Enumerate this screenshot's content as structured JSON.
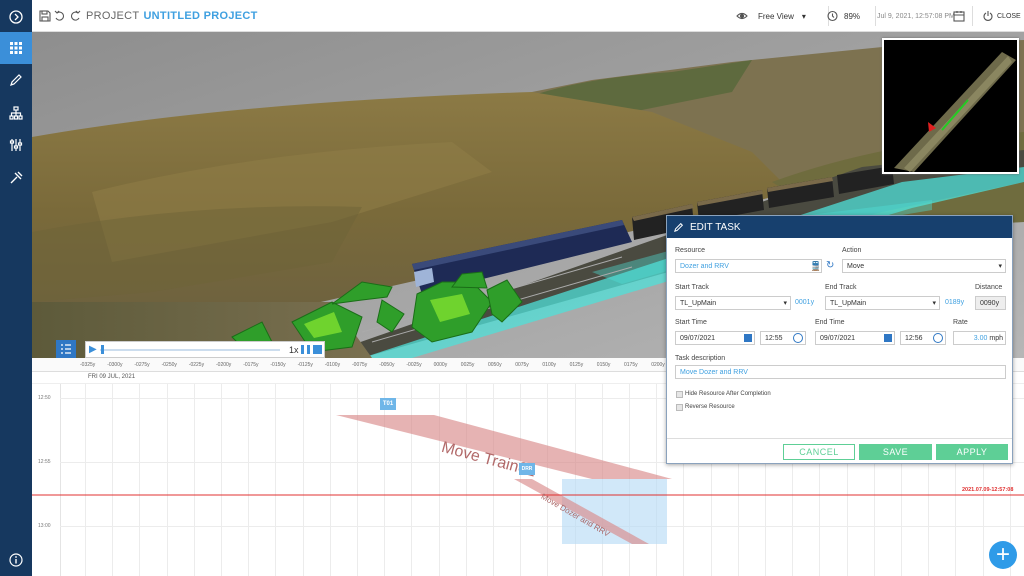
{
  "topbar": {
    "project_prefix": "PROJECT",
    "project_name": "UNTITLED PROJECT",
    "view_mode": "Free View",
    "zoom": "89%",
    "datetime": "Jul 9, 2021, 12:57:08 PM",
    "close_label": "CLOSE"
  },
  "playback": {
    "speed": "1x"
  },
  "timeline": {
    "date_label": "FRI 09 JUL, 2021",
    "ruler_ticks": [
      "-0325y",
      "-0300y",
      "-0275y",
      "-0250y",
      "-0225y",
      "-0200y",
      "-0175y",
      "-0150y",
      "-0125y",
      "-0100y",
      "-0075y",
      "-0050y",
      "-0025y",
      "0000y",
      "0025y",
      "0050y",
      "0075y",
      "0100y",
      "0125y",
      "0150y",
      "0175y",
      "0200y"
    ],
    "time_labels": [
      "12:50",
      "12:55",
      "13:00"
    ],
    "now_label": "2021.07.09-12:57:08",
    "tasks": [
      {
        "badge": "T01",
        "label": "Move Train01"
      },
      {
        "badge": "DRR",
        "label": "Move Dozer and RRV"
      }
    ]
  },
  "edit_task": {
    "title": "EDIT TASK",
    "resource_label": "Resource",
    "resource_value": "Dozer and RRV",
    "action_label": "Action",
    "action_value": "Move",
    "start_track_label": "Start Track",
    "start_track_value": "TL_UpMain",
    "start_track_offset": "0001y",
    "end_track_label": "End Track",
    "end_track_value": "TL_UpMain",
    "end_track_offset": "0189y",
    "distance_label": "Distance",
    "distance_value": "0090y",
    "start_time_label": "Start Time",
    "start_date": "09/07/2021",
    "start_clock": "12:55",
    "end_time_label": "End Time",
    "end_date": "09/07/2021",
    "end_clock": "12:56",
    "rate_label": "Rate",
    "rate_value": "3.00",
    "rate_unit": "mph",
    "desc_label": "Task description",
    "desc_value": "Move Dozer and RRV",
    "hide_label": "Hide Resource After Completion",
    "reverse_label": "Reverse Resource",
    "cancel": "CANCEL",
    "save": "SAVE",
    "apply": "APPLY"
  },
  "colors": {
    "sidebar": "#16385f",
    "accent": "#3b8fd9",
    "header": "#17406e",
    "button_green": "#5ecf96",
    "now_line": "#e03030"
  }
}
